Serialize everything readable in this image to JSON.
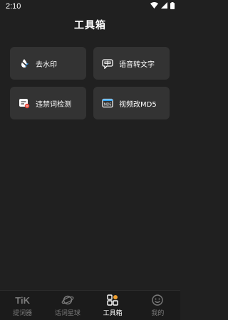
{
  "status_bar": {
    "time": "2:10",
    "icons": [
      "wifi-icon",
      "signal-icon",
      "battery-icon"
    ]
  },
  "header": {
    "title": "工具箱"
  },
  "tools": [
    {
      "label": "去水印",
      "icon": "watermark-remove-icon"
    },
    {
      "label": "语音转文字",
      "icon": "speech-to-text-icon"
    },
    {
      "label": "违禁词检测",
      "icon": "banned-word-check-icon"
    },
    {
      "label": "视频改MD5",
      "icon": "video-md5-icon"
    }
  ],
  "tab_bar": {
    "tabs": [
      {
        "label": "提词器",
        "icon": "tik-icon",
        "icon_text": "TiK",
        "active": false
      },
      {
        "label": "话词星球",
        "icon": "planet-icon",
        "active": false
      },
      {
        "label": "工具箱",
        "icon": "toolbox-icon",
        "active": true
      },
      {
        "label": "我的",
        "icon": "smiley-icon",
        "active": false
      }
    ]
  },
  "colors": {
    "background": "#202020",
    "card": "#333333",
    "tab_inactive": "#7b7b7b",
    "tab_active": "#ffffff",
    "badge_red": "#e5483b"
  }
}
